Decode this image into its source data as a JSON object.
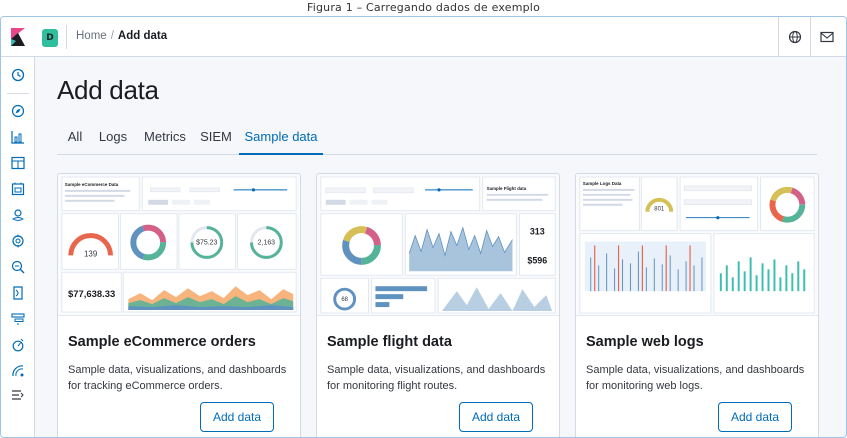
{
  "caption": "Figura 1 – Carregando dados de exemplo",
  "space_initial": "D",
  "breadcrumb": {
    "home": "Home",
    "separator": "/",
    "current": "Add data"
  },
  "page_title": "Add data",
  "tabs": [
    "All",
    "Logs",
    "Metrics",
    "SIEM",
    "Sample data"
  ],
  "active_tab": "Sample data",
  "nav_icons": [
    "clock-icon",
    "compass-icon",
    "visualize-icon",
    "dashboard-icon",
    "canvas-icon",
    "maps-icon",
    "ml-icon",
    "infrastructure-icon",
    "logs-icon",
    "apm-icon",
    "uptime-icon",
    "devtools-icon",
    "monitoring-icon",
    "collapse-icon"
  ],
  "cards": [
    {
      "title": "Sample eCommerce orders",
      "description": "Sample data, visualizations, and dashboards for tracking eCommerce orders.",
      "button": "Add data",
      "thumb": {
        "heading": "Sample eCommerce Data",
        "big_number": "$77,638.33",
        "gauge_value": "139",
        "metric_a": "$75.23",
        "metric_b": "2,163"
      }
    },
    {
      "title": "Sample flight data",
      "description": "Sample data, visualizations, and dashboards for monitoring flight routes.",
      "button": "Add data",
      "thumb": {
        "heading": "Sample Flight data",
        "metric_a": "313",
        "metric_b": "$596",
        "gauge_value": "68"
      }
    },
    {
      "title": "Sample web logs",
      "description": "Sample data, visualizations, and dashboards for monitoring web logs.",
      "button": "Add data",
      "thumb": {
        "heading": "Sample Logs Data",
        "gauge_value": "801"
      }
    }
  ],
  "colors": {
    "accent": "#006bb8",
    "space_badge": "#2fbf9e",
    "logo_pink": "#e8488b",
    "logo_teal": "#3ebeb0"
  }
}
